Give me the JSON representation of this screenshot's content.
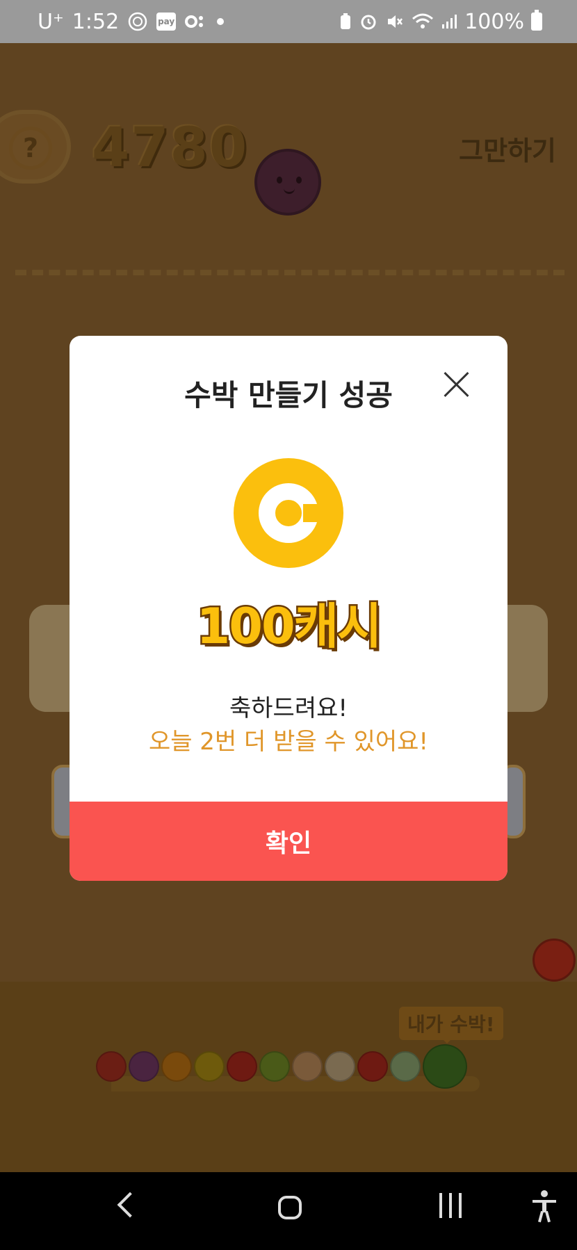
{
  "status_bar": {
    "carrier": "U⁺",
    "time": "1:52",
    "pay_label": "pay",
    "battery": "100%",
    "icons": [
      "gem-icon",
      "pay-icon",
      "oo-icon",
      "dot-icon",
      "battery-saver-icon",
      "alarm-icon",
      "mute-icon",
      "wifi-icon",
      "signal-icon",
      "battery-icon"
    ]
  },
  "game": {
    "help_label": "?",
    "score": "4780",
    "quit_label": "그만하기",
    "badge_label": "내가 수박!",
    "fruit_colors": [
      "#6b1e14",
      "#4a2440",
      "#7a4a0c",
      "#6e5a0c",
      "#6e1a12",
      "#4a5a18",
      "#7a5a3a",
      "#7a6a50",
      "#6e1a12",
      "#5a6a48",
      "#2b4a16"
    ]
  },
  "modal": {
    "title": "수박 만들기 성공",
    "coin_symbol": "C",
    "reward": "100캐시",
    "congrats": "축하드려요!",
    "remaining": "오늘 2번 더 받을 수 있어요!",
    "confirm_label": "확인",
    "accent_color": "#fa5450",
    "coin_color": "#fbbf0d"
  },
  "nav": {
    "icons": [
      "back-icon",
      "home-icon",
      "recents-icon",
      "accessibility-icon"
    ]
  }
}
